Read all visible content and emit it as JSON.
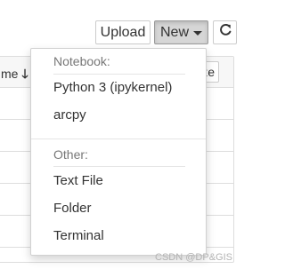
{
  "toolbar": {
    "upload_label": "Upload",
    "new_label": "New",
    "refresh_icon": "refresh-icon"
  },
  "file_list": {
    "sort_label": "me",
    "sort_arrow": "🡓",
    "header_button_text": "ze"
  },
  "dropdown": {
    "notebook_header": "Notebook:",
    "notebook_items": [
      {
        "label": "Python 3 (ipykernel)"
      },
      {
        "label": "arcpy"
      }
    ],
    "other_header": "Other:",
    "other_items": [
      {
        "label": "Text File"
      },
      {
        "label": "Folder"
      },
      {
        "label": "Terminal"
      }
    ]
  },
  "watermark": "CSDN @DP&GIS"
}
